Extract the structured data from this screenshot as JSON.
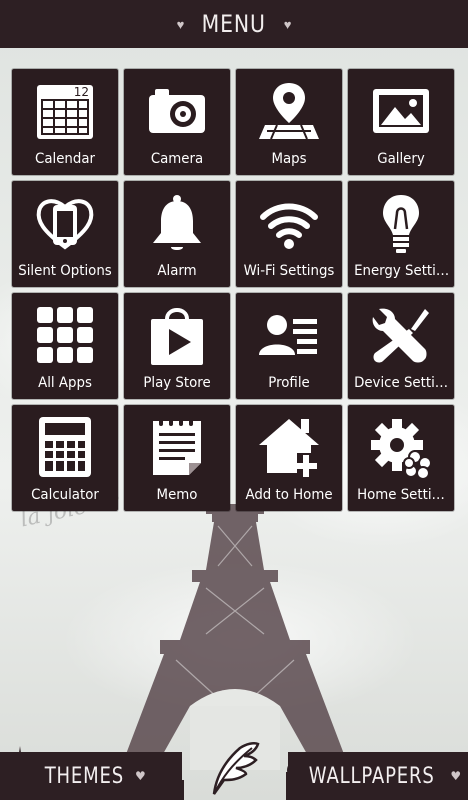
{
  "header": {
    "title": "MENU",
    "left_icon": "heart-icon",
    "right_icon": "heart-icon"
  },
  "tiles": [
    {
      "label": "Calendar",
      "icon": "calendar-icon",
      "date": "12"
    },
    {
      "label": "Camera",
      "icon": "camera-icon"
    },
    {
      "label": "Maps",
      "icon": "map-pin-icon"
    },
    {
      "label": "Gallery",
      "icon": "image-icon"
    },
    {
      "label": "Silent Options",
      "icon": "heart-phone-icon"
    },
    {
      "label": "Alarm",
      "icon": "bell-icon"
    },
    {
      "label": "Wi-Fi Settings",
      "icon": "wifi-icon"
    },
    {
      "label": "Energy Setti…",
      "icon": "lightbulb-icon"
    },
    {
      "label": "All Apps",
      "icon": "apps-grid-icon"
    },
    {
      "label": "Play Store",
      "icon": "play-bag-icon"
    },
    {
      "label": "Profile",
      "icon": "profile-card-icon"
    },
    {
      "label": "Device Setti…",
      "icon": "tools-icon"
    },
    {
      "label": "Calculator",
      "icon": "calculator-icon"
    },
    {
      "label": "Memo",
      "icon": "notepad-icon"
    },
    {
      "label": "Add to Home",
      "icon": "home-add-icon"
    },
    {
      "label": "Home Setti…",
      "icon": "gear-flower-icon"
    }
  ],
  "wallpaper_text": "la joie de vivre",
  "bottom": {
    "themes_label": "THEMES",
    "wallpapers_label": "WALLPAPERS",
    "center_icon": "feather-icon"
  },
  "colors": {
    "bar": "#2d1f23",
    "tile": "#2a1c1f",
    "icon": "#ffffff"
  }
}
